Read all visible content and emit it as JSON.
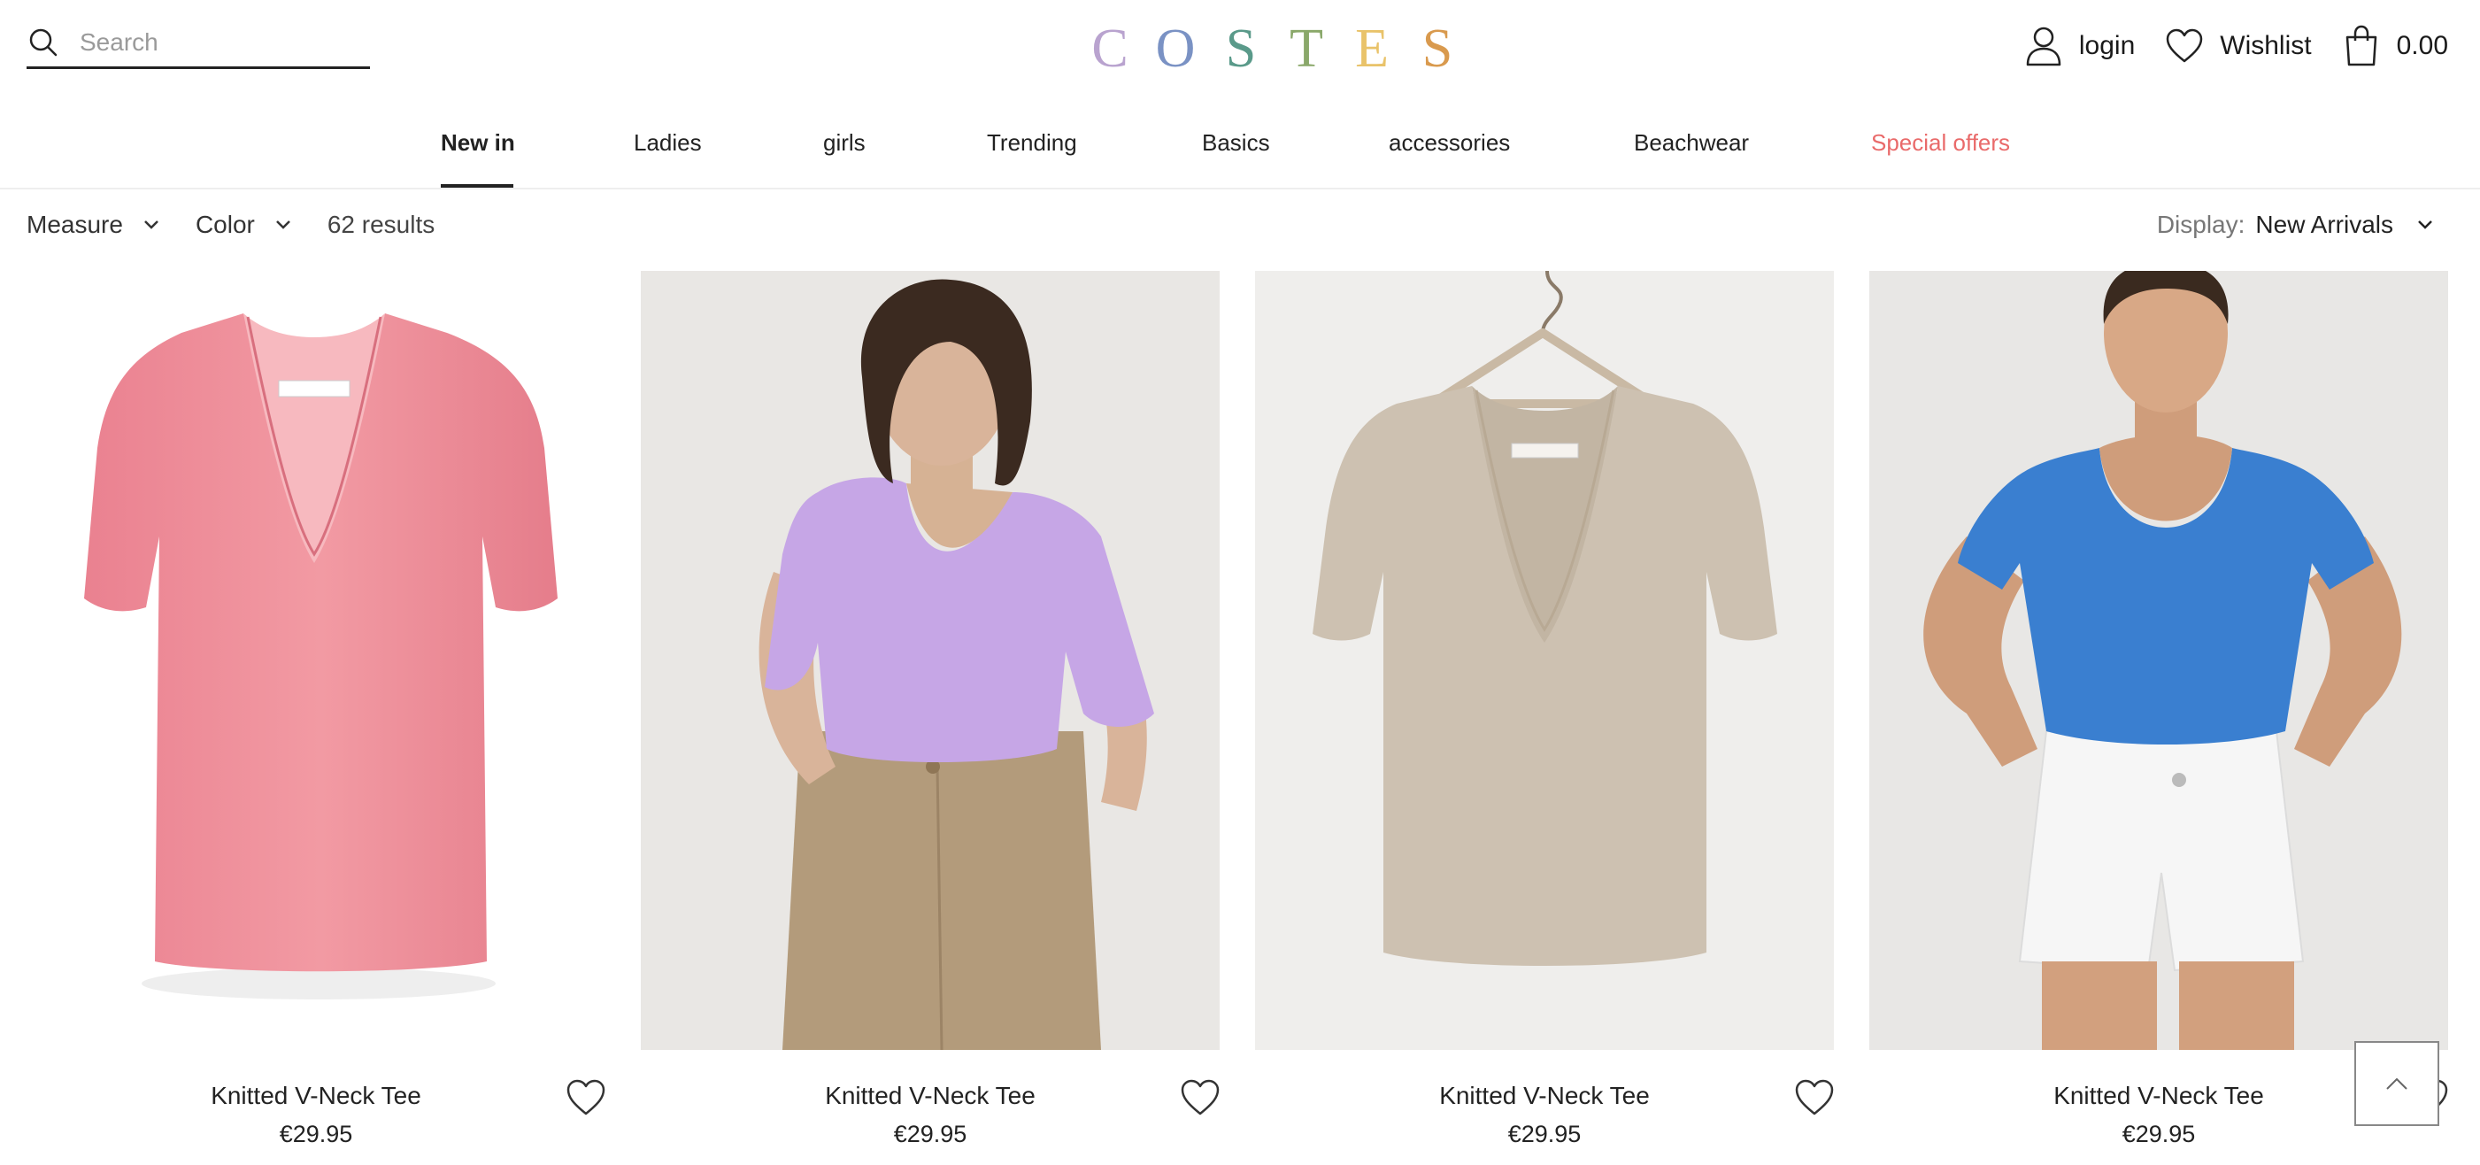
{
  "search": {
    "placeholder": "Search"
  },
  "logo": {
    "letters": [
      "C",
      "O",
      "S",
      "T",
      "E",
      "S"
    ],
    "colors": [
      "#b9a3cf",
      "#7a92c4",
      "#5a9a8a",
      "#8aa86a",
      "#e9c36a",
      "#d99a4e"
    ]
  },
  "header_actions": {
    "login_label": "login",
    "wishlist_label": "Wishlist",
    "cart_total": "0.00"
  },
  "nav": {
    "items": [
      {
        "label": "New in",
        "active": true
      },
      {
        "label": "Ladies"
      },
      {
        "label": "girls"
      },
      {
        "label": "Trending"
      },
      {
        "label": "Basics"
      },
      {
        "label": "accessories"
      },
      {
        "label": "Beachwear"
      },
      {
        "label": "Special offers",
        "color": "#e96a6a"
      }
    ]
  },
  "filters": {
    "measure_label": "Measure",
    "color_label": "Color",
    "results_text": "62 results",
    "display_label": "Display:",
    "display_value": "New Arrivals"
  },
  "products": [
    {
      "title": "Knitted V-Neck Tee",
      "price": "€29.95",
      "color_name": "pink",
      "color": "#ef8c96"
    },
    {
      "title": "Knitted V-Neck Tee",
      "price": "€29.95",
      "color_name": "lilac",
      "color": "#c9a9e8"
    },
    {
      "title": "Knitted V-Neck Tee",
      "price": "€29.95",
      "color_name": "beige",
      "color": "#cfc3b2"
    },
    {
      "title": "Knitted V-Neck Tee",
      "price": "€29.95",
      "color_name": "blue",
      "color": "#3a7fd0"
    }
  ]
}
